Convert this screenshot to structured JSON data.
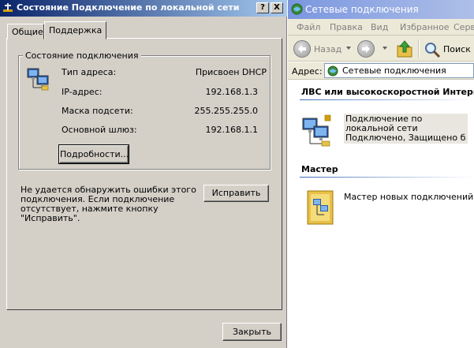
{
  "dialog": {
    "title": "Состояние Подключение по локальной сети",
    "help_btn": "?",
    "close_btn": "X",
    "tabs": [
      "Общие",
      "Поддержка"
    ],
    "group_title": "Состояние подключения",
    "rows": [
      {
        "label": "Тип адреса:",
        "value": "Присвоен DHCP"
      },
      {
        "label": "IP-адрес:",
        "value": "192.168.1.3"
      },
      {
        "label": "Маска подсети:",
        "value": "255.255.255.0"
      },
      {
        "label": "Основной шлюз:",
        "value": "192.168.1.1"
      }
    ],
    "details_button": "Подробности...",
    "error_text": "Не удается обнаружить ошибки этого подключения. Если подключение отсутствует, нажмите кнопку \"Исправить\".",
    "repair_button": "Исправить",
    "close_button": "Закрыть"
  },
  "explorer": {
    "title": "Сетевые подключения",
    "menu": [
      "Файл",
      "Правка",
      "Вид",
      "Избранное",
      "Серв"
    ],
    "back_label": "Назад",
    "search_label": "Поиск",
    "address_label": "Адрес:",
    "address_value": "Сетевые подключения",
    "section_lan": "ЛВС или высокоскоростной Интернет",
    "lan_item": {
      "name": "Подключение по локальной сети",
      "status": "Подключено, Защищено бр..."
    },
    "section_wizard": "Мастер",
    "wizard_item": "Мастер новых подключений"
  }
}
